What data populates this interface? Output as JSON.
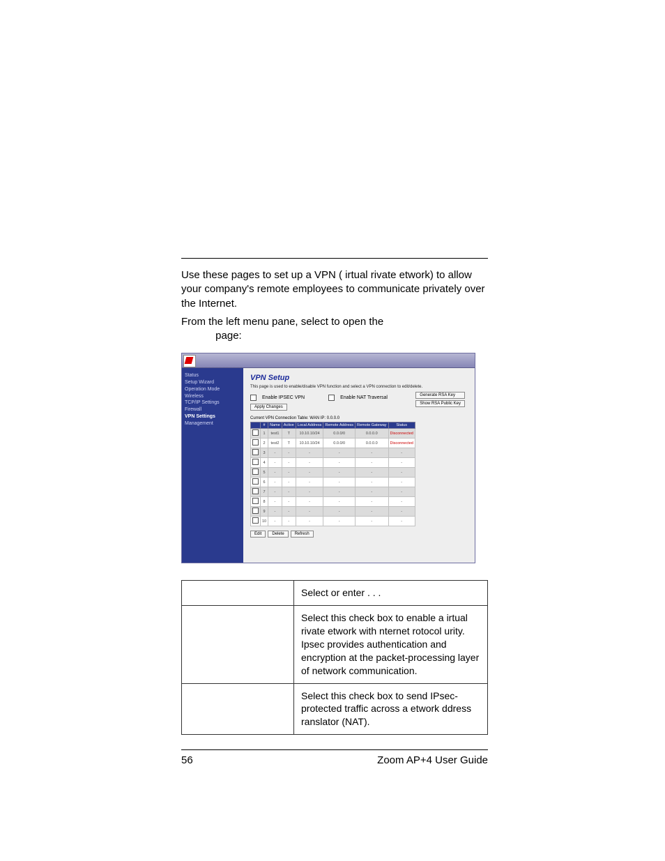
{
  "body": {
    "p1": "Use these pages to set up a VPN (   irtual    rivate    etwork) to allow your company's remote employees to communicate privately over the Internet.",
    "p2a": "From the left menu pane, select ",
    "p2b": " to open the ",
    "p3": " page:"
  },
  "screenshot": {
    "side": {
      "items": [
        "Status",
        "Setup Wizard",
        "Operation Mode",
        "Wireless",
        "TCP/IP Settings",
        "Firewall",
        "VPN Settings",
        "Management"
      ]
    },
    "title": "VPN Setup",
    "subtitle": "This page is used to enable/disable VPN function and select a VPN connection to edit/delete.",
    "chk1": "Enable IPSEC VPN",
    "chk2": "Enable NAT Traversal",
    "apply": "Apply Changes",
    "gen": "Generate RSA Key",
    "show": "Show RSA Public Key",
    "tableCaption": "Current VPN Connection Table:   WAN IP: 0.0.0.0",
    "headers": [
      "",
      "#",
      "Name",
      "Active",
      "Local Address",
      "Remote Address",
      "Remote Gateway",
      "Status"
    ],
    "rows": [
      {
        "n": "1",
        "name": "test1",
        "act": "T",
        "la": "10.10.10/24",
        "ra": "0.0.0/0",
        "rg": "0.0.0.0",
        "st": "Disconnected"
      },
      {
        "n": "2",
        "name": "test2",
        "act": "T",
        "la": "10.10.10/24",
        "ra": "0.0.0/0",
        "rg": "0.0.0.0",
        "st": "Disconnected"
      },
      {
        "n": "3",
        "name": "-",
        "act": "-",
        "la": "-",
        "ra": "-",
        "rg": "-",
        "st": "-"
      },
      {
        "n": "4",
        "name": "-",
        "act": "-",
        "la": "-",
        "ra": "-",
        "rg": "-",
        "st": "-"
      },
      {
        "n": "5",
        "name": "-",
        "act": "-",
        "la": "-",
        "ra": "-",
        "rg": "-",
        "st": "-"
      },
      {
        "n": "6",
        "name": "-",
        "act": "-",
        "la": "-",
        "ra": "-",
        "rg": "-",
        "st": "-"
      },
      {
        "n": "7",
        "name": "-",
        "act": "-",
        "la": "-",
        "ra": "-",
        "rg": "-",
        "st": "-"
      },
      {
        "n": "8",
        "name": "-",
        "act": "-",
        "la": "-",
        "ra": "-",
        "rg": "-",
        "st": "-"
      },
      {
        "n": "9",
        "name": "-",
        "act": "-",
        "la": "-",
        "ra": "-",
        "rg": "-",
        "st": "-"
      },
      {
        "n": "10",
        "name": "-",
        "act": "-",
        "la": "-",
        "ra": "-",
        "rg": "-",
        "st": "-"
      }
    ],
    "edit": "Edit",
    "delete": "Delete",
    "refresh": "Refresh"
  },
  "desc": {
    "h": "Select or enter . . .",
    "r1": "Select this check box to enable a    irtual    rivate    etwork with  nternet    rotocol       urity. Ipsec provides authentication and encryption at the packet-processing layer of network communication.",
    "r2": "Select this check box to send IPsec-protected traffic across a    etwork    ddress    ranslator (NAT)."
  },
  "footer": {
    "page": "56",
    "guide": "Zoom AP+4 User Guide"
  }
}
